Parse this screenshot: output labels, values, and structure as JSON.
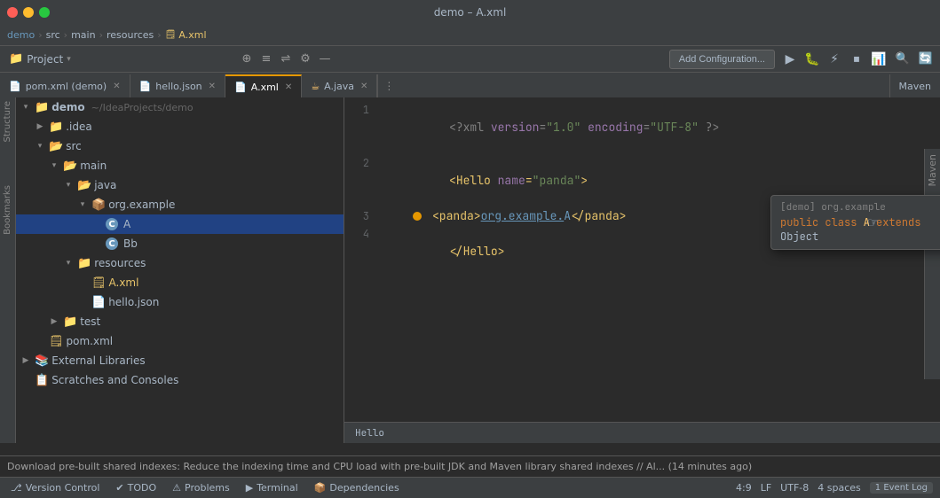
{
  "window": {
    "title": "demo – A.xml"
  },
  "breadcrumb": {
    "items": [
      "demo",
      "src",
      "main",
      "resources",
      "A.xml"
    ]
  },
  "project_panel": {
    "label": "Project",
    "chevron": "▾"
  },
  "tabs": [
    {
      "id": "pom",
      "label": "pom.xml (demo)",
      "active": false,
      "icon": "📄"
    },
    {
      "id": "hello",
      "label": "hello.json",
      "active": false,
      "icon": "📄"
    },
    {
      "id": "axml",
      "label": "A.xml",
      "active": true,
      "icon": "📄"
    },
    {
      "id": "ajava",
      "label": "A.java",
      "active": false,
      "icon": "☕"
    }
  ],
  "editor": {
    "lines": [
      {
        "num": "1",
        "content": "<?xml version=\"1.0\" encoding=\"UTF-8\" ?>"
      },
      {
        "num": "2",
        "content": "<Hello name=\"panda\">"
      },
      {
        "num": "3",
        "content": "    <panda>org.example.A</panda>"
      },
      {
        "num": "4",
        "content": "</Hello>"
      }
    ]
  },
  "tooltip": {
    "module": "[demo] org.example",
    "signature": "public class A extends Object"
  },
  "tree": {
    "items": [
      {
        "indent": 0,
        "arrow": "▾",
        "icon": "📁",
        "label": "demo",
        "extra": "~/IdeaProjects/demo",
        "type": "root-folder"
      },
      {
        "indent": 1,
        "arrow": "▶",
        "icon": "📁",
        "label": ".idea",
        "type": "folder"
      },
      {
        "indent": 1,
        "arrow": "▾",
        "icon": "📂",
        "label": "src",
        "type": "src-folder"
      },
      {
        "indent": 2,
        "arrow": "▾",
        "icon": "📂",
        "label": "main",
        "type": "src-folder"
      },
      {
        "indent": 3,
        "arrow": "▾",
        "icon": "📂",
        "label": "java",
        "type": "src-folder"
      },
      {
        "indent": 4,
        "arrow": "▾",
        "icon": "📦",
        "label": "org.example",
        "type": "package"
      },
      {
        "indent": 5,
        "arrow": "",
        "icon": "🅰",
        "label": "A",
        "type": "java-class",
        "selected": true
      },
      {
        "indent": 5,
        "arrow": "",
        "icon": "🅱",
        "label": "Bb",
        "type": "java-class"
      },
      {
        "indent": 3,
        "arrow": "▾",
        "icon": "📁",
        "label": "resources",
        "type": "res-folder"
      },
      {
        "indent": 4,
        "arrow": "",
        "icon": "📄",
        "label": "A.xml",
        "type": "xml"
      },
      {
        "indent": 4,
        "arrow": "",
        "icon": "📄",
        "label": "hello.json",
        "type": "json"
      },
      {
        "indent": 2,
        "arrow": "▶",
        "icon": "📁",
        "label": "test",
        "type": "folder"
      },
      {
        "indent": 1,
        "arrow": "",
        "icon": "📄",
        "label": "pom.xml",
        "type": "pom"
      },
      {
        "indent": 0,
        "arrow": "▶",
        "icon": "📚",
        "label": "External Libraries",
        "type": "library"
      },
      {
        "indent": 0,
        "arrow": "",
        "icon": "📋",
        "label": "Scratches and Consoles",
        "type": "scratches"
      }
    ]
  },
  "status_bar": {
    "vc_label": "Version Control",
    "todo_label": "TODO",
    "problems_label": "Problems",
    "terminal_label": "Terminal",
    "dependencies_label": "Dependencies",
    "position": "4:9",
    "indent": "LF",
    "encoding": "UTF-8",
    "spaces": "4 spaces",
    "event_log_count": "1",
    "event_log_label": "Event Log"
  },
  "message_bar": {
    "text": "Download pre-built shared indexes: Reduce the indexing time and CPU load with pre-built JDK and Maven library shared indexes // Al... (14 minutes ago)"
  },
  "toolbar": {
    "add_config_label": "Add Configuration...",
    "icons": [
      "⊕",
      "≡",
      "⇌",
      "⚙",
      "—"
    ]
  },
  "colors": {
    "accent": "#e59700",
    "selected_bg": "#214283",
    "active_tab_border": "#e59700"
  }
}
